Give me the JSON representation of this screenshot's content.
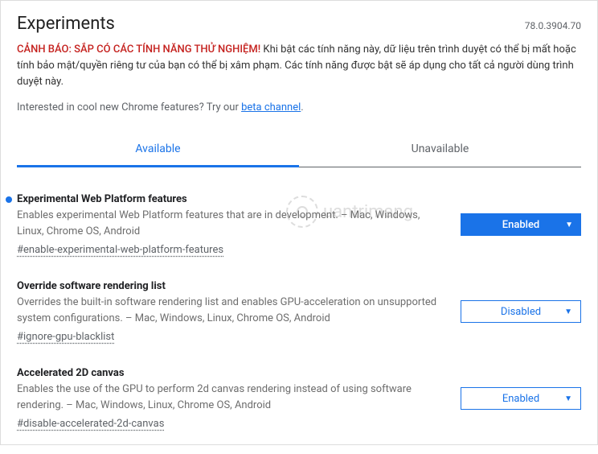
{
  "header": {
    "title": "Experiments",
    "version": "78.0.3904.70"
  },
  "warning": {
    "bold": "CẢNH BÁO: SẮP CÓ CÁC TÍNH NĂNG THỬ NGHIỆM!",
    "body": " Khi bật các tính năng này, dữ liệu trên trình duyệt có thể bị mất hoặc tính bảo mật/quyền riêng tư của bạn có thể bị xâm phạm. Các tính năng được bật sẽ áp dụng cho tất cả người dùng trình duyệt này."
  },
  "interested": {
    "prefix": "Interested in cool new Chrome features? Try our ",
    "link": "beta channel",
    "suffix": "."
  },
  "tabs": {
    "available": "Available",
    "unavailable": "Unavailable"
  },
  "flags": [
    {
      "title": "Experimental Web Platform features",
      "desc": "Enables experimental Web Platform features that are in development. – Mac, Windows, Linux, Chrome OS, Android",
      "hash": "#enable-experimental-web-platform-features",
      "state": "Enabled",
      "highlighted": true,
      "bullet": true
    },
    {
      "title": "Override software rendering list",
      "desc": "Overrides the built-in software rendering list and enables GPU-acceleration on unsupported system configurations. – Mac, Windows, Linux, Chrome OS, Android",
      "hash": "#ignore-gpu-blacklist",
      "state": "Disabled",
      "highlighted": false,
      "bullet": false
    },
    {
      "title": "Accelerated 2D canvas",
      "desc": "Enables the use of the GPU to perform 2d canvas rendering instead of using software rendering. – Mac, Windows, Linux, Chrome OS, Android",
      "hash": "#disable-accelerated-2d-canvas",
      "state": "Enabled",
      "highlighted": false,
      "bullet": false
    }
  ],
  "watermark": "uantrimang"
}
